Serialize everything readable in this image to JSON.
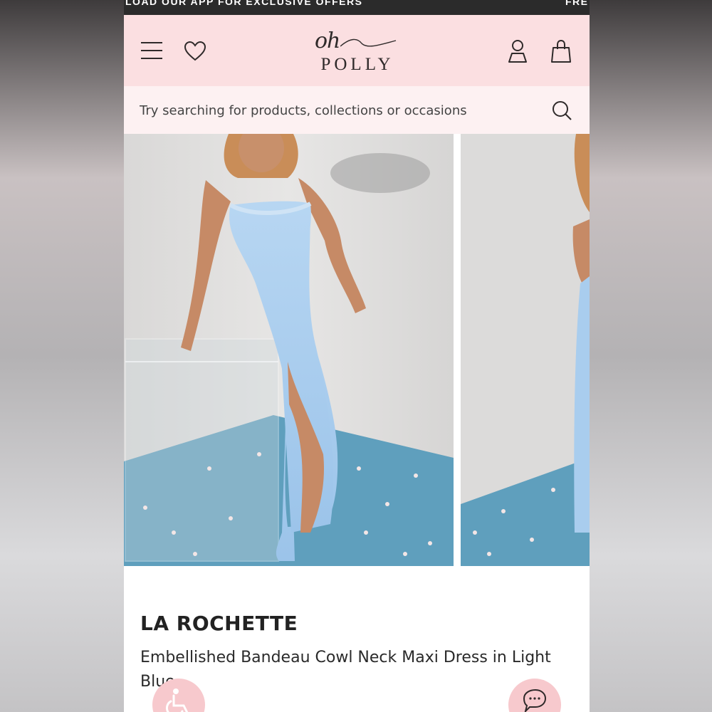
{
  "promo_bar": {
    "text_left": "LOAD OUR APP FOR EXCLUSIVE OFFERS",
    "text_right": "FRE"
  },
  "header": {
    "logo_script": "oh",
    "logo_word": "POLLY",
    "icons": [
      "menu-icon",
      "heart-icon",
      "account-icon",
      "bag-icon"
    ]
  },
  "search": {
    "placeholder": "Try searching for products, collections or occasions",
    "value": "",
    "icon": "search-icon"
  },
  "gallery": {
    "images": [
      "product-photo-front",
      "product-photo-side"
    ]
  },
  "product": {
    "brand": "LA ROCHETTE",
    "name": "Embellished Bandeau Cowl Neck Maxi Dress in Light Blue"
  },
  "floating_buttons": {
    "accessibility_icon": "wheelchair-icon",
    "chat_icon": "chat-bubbles-icon"
  },
  "colors": {
    "header_pink": "#fbdfe1",
    "search_bg": "#fdf1f2",
    "promo_bg": "#2b2b2b",
    "dress_blue": "#a9cdee",
    "floor_blue": "#5f9fbd",
    "fab_pink": "#f7c9cd"
  }
}
